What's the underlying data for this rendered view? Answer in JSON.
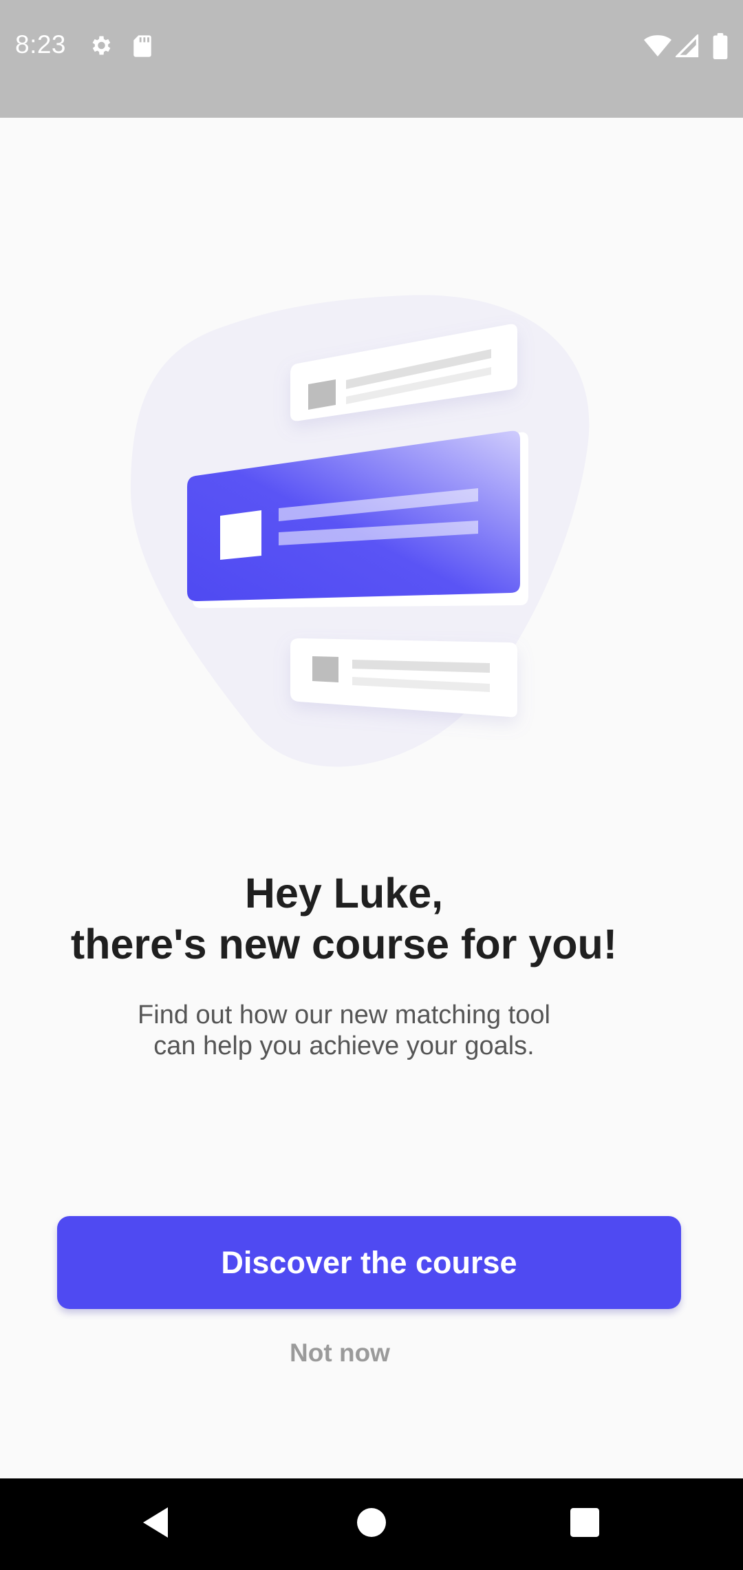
{
  "status_bar": {
    "time": "8:23",
    "icons": [
      "gear-icon",
      "sd-card-icon",
      "wifi-icon",
      "signal-icon",
      "battery-icon"
    ]
  },
  "illustration": {
    "icon": "course-cards-illustration",
    "colors": {
      "blob": "#f1f0f8",
      "card_gradient_start": "#4f4af2",
      "card_gradient_end": "#c9c6fb"
    }
  },
  "headline": {
    "line1": "Hey Luke,",
    "line2": "there's new course for you!"
  },
  "subtext": {
    "line1": "Find out how our new matching tool",
    "line2": "can help you achieve your goals."
  },
  "primary_button": {
    "label": "Discover the course",
    "color": "#4f4af2"
  },
  "secondary_link": {
    "label": "Not now"
  },
  "nav_bar": {
    "icons": [
      "back-icon",
      "home-icon",
      "recents-icon"
    ]
  }
}
